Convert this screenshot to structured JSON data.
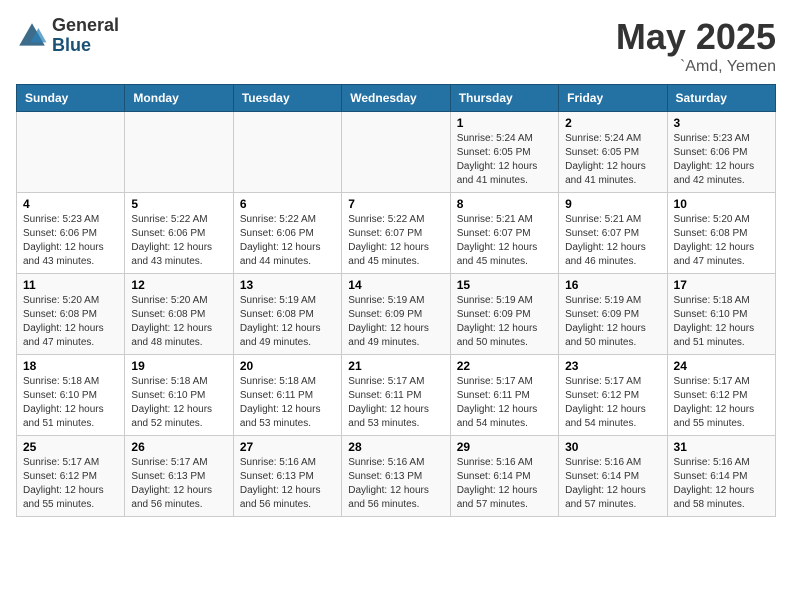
{
  "logo": {
    "general": "General",
    "blue": "Blue"
  },
  "title": {
    "month_year": "May 2025",
    "location": "`Amd, Yemen"
  },
  "weekdays": [
    "Sunday",
    "Monday",
    "Tuesday",
    "Wednesday",
    "Thursday",
    "Friday",
    "Saturday"
  ],
  "weeks": [
    [
      {
        "day": "",
        "info": ""
      },
      {
        "day": "",
        "info": ""
      },
      {
        "day": "",
        "info": ""
      },
      {
        "day": "",
        "info": ""
      },
      {
        "day": "1",
        "info": "Sunrise: 5:24 AM\nSunset: 6:05 PM\nDaylight: 12 hours\nand 41 minutes."
      },
      {
        "day": "2",
        "info": "Sunrise: 5:24 AM\nSunset: 6:05 PM\nDaylight: 12 hours\nand 41 minutes."
      },
      {
        "day": "3",
        "info": "Sunrise: 5:23 AM\nSunset: 6:06 PM\nDaylight: 12 hours\nand 42 minutes."
      }
    ],
    [
      {
        "day": "4",
        "info": "Sunrise: 5:23 AM\nSunset: 6:06 PM\nDaylight: 12 hours\nand 43 minutes."
      },
      {
        "day": "5",
        "info": "Sunrise: 5:22 AM\nSunset: 6:06 PM\nDaylight: 12 hours\nand 43 minutes."
      },
      {
        "day": "6",
        "info": "Sunrise: 5:22 AM\nSunset: 6:06 PM\nDaylight: 12 hours\nand 44 minutes."
      },
      {
        "day": "7",
        "info": "Sunrise: 5:22 AM\nSunset: 6:07 PM\nDaylight: 12 hours\nand 45 minutes."
      },
      {
        "day": "8",
        "info": "Sunrise: 5:21 AM\nSunset: 6:07 PM\nDaylight: 12 hours\nand 45 minutes."
      },
      {
        "day": "9",
        "info": "Sunrise: 5:21 AM\nSunset: 6:07 PM\nDaylight: 12 hours\nand 46 minutes."
      },
      {
        "day": "10",
        "info": "Sunrise: 5:20 AM\nSunset: 6:08 PM\nDaylight: 12 hours\nand 47 minutes."
      }
    ],
    [
      {
        "day": "11",
        "info": "Sunrise: 5:20 AM\nSunset: 6:08 PM\nDaylight: 12 hours\nand 47 minutes."
      },
      {
        "day": "12",
        "info": "Sunrise: 5:20 AM\nSunset: 6:08 PM\nDaylight: 12 hours\nand 48 minutes."
      },
      {
        "day": "13",
        "info": "Sunrise: 5:19 AM\nSunset: 6:08 PM\nDaylight: 12 hours\nand 49 minutes."
      },
      {
        "day": "14",
        "info": "Sunrise: 5:19 AM\nSunset: 6:09 PM\nDaylight: 12 hours\nand 49 minutes."
      },
      {
        "day": "15",
        "info": "Sunrise: 5:19 AM\nSunset: 6:09 PM\nDaylight: 12 hours\nand 50 minutes."
      },
      {
        "day": "16",
        "info": "Sunrise: 5:19 AM\nSunset: 6:09 PM\nDaylight: 12 hours\nand 50 minutes."
      },
      {
        "day": "17",
        "info": "Sunrise: 5:18 AM\nSunset: 6:10 PM\nDaylight: 12 hours\nand 51 minutes."
      }
    ],
    [
      {
        "day": "18",
        "info": "Sunrise: 5:18 AM\nSunset: 6:10 PM\nDaylight: 12 hours\nand 51 minutes."
      },
      {
        "day": "19",
        "info": "Sunrise: 5:18 AM\nSunset: 6:10 PM\nDaylight: 12 hours\nand 52 minutes."
      },
      {
        "day": "20",
        "info": "Sunrise: 5:18 AM\nSunset: 6:11 PM\nDaylight: 12 hours\nand 53 minutes."
      },
      {
        "day": "21",
        "info": "Sunrise: 5:17 AM\nSunset: 6:11 PM\nDaylight: 12 hours\nand 53 minutes."
      },
      {
        "day": "22",
        "info": "Sunrise: 5:17 AM\nSunset: 6:11 PM\nDaylight: 12 hours\nand 54 minutes."
      },
      {
        "day": "23",
        "info": "Sunrise: 5:17 AM\nSunset: 6:12 PM\nDaylight: 12 hours\nand 54 minutes."
      },
      {
        "day": "24",
        "info": "Sunrise: 5:17 AM\nSunset: 6:12 PM\nDaylight: 12 hours\nand 55 minutes."
      }
    ],
    [
      {
        "day": "25",
        "info": "Sunrise: 5:17 AM\nSunset: 6:12 PM\nDaylight: 12 hours\nand 55 minutes."
      },
      {
        "day": "26",
        "info": "Sunrise: 5:17 AM\nSunset: 6:13 PM\nDaylight: 12 hours\nand 56 minutes."
      },
      {
        "day": "27",
        "info": "Sunrise: 5:16 AM\nSunset: 6:13 PM\nDaylight: 12 hours\nand 56 minutes."
      },
      {
        "day": "28",
        "info": "Sunrise: 5:16 AM\nSunset: 6:13 PM\nDaylight: 12 hours\nand 56 minutes."
      },
      {
        "day": "29",
        "info": "Sunrise: 5:16 AM\nSunset: 6:14 PM\nDaylight: 12 hours\nand 57 minutes."
      },
      {
        "day": "30",
        "info": "Sunrise: 5:16 AM\nSunset: 6:14 PM\nDaylight: 12 hours\nand 57 minutes."
      },
      {
        "day": "31",
        "info": "Sunrise: 5:16 AM\nSunset: 6:14 PM\nDaylight: 12 hours\nand 58 minutes."
      }
    ]
  ]
}
